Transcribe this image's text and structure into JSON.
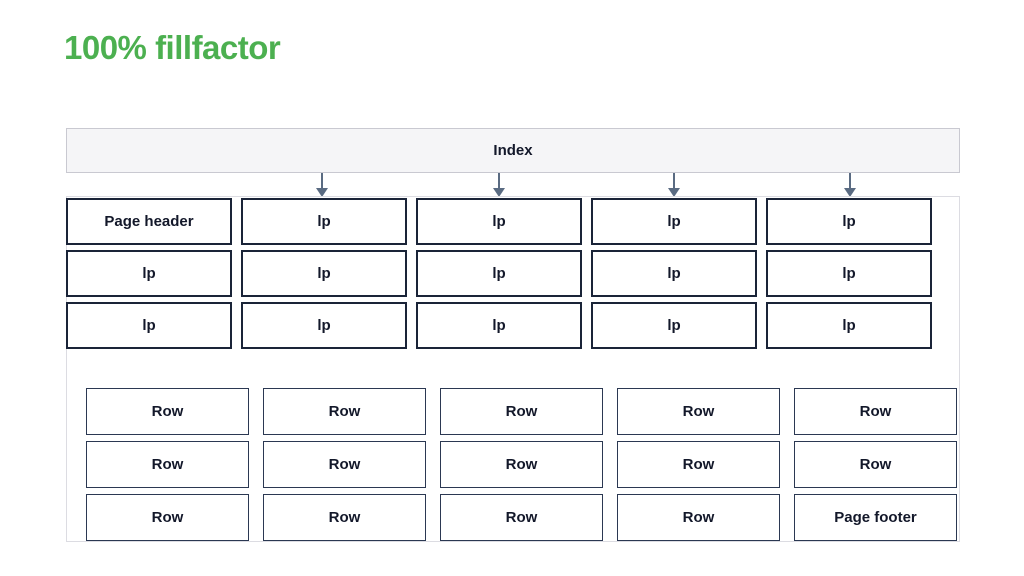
{
  "slide": {
    "title": "100% fillfactor",
    "title_color": "#4cb050"
  },
  "index": {
    "label": "Index",
    "fill_color": "#f5f5f7",
    "border_color": "#c9c9d1"
  },
  "arrows": {
    "count": 4,
    "color": "#5a6b82",
    "targets": [
      "lp-column-2",
      "lp-column-3",
      "lp-column-4",
      "lp-column-5"
    ]
  },
  "page": {
    "border_color": "#dcdce2",
    "box_border_color": "#1a2438",
    "row_border_color": "#2b3852",
    "text_color": "#13182a"
  },
  "lp_grid": {
    "columns": 5,
    "rows": 3,
    "cells": [
      "Page header",
      "lp",
      "lp",
      "lp",
      "lp",
      "lp",
      "lp",
      "lp",
      "lp",
      "lp",
      "lp",
      "lp",
      "lp",
      "lp",
      "lp"
    ]
  },
  "row_grid": {
    "columns": 5,
    "rows": 3,
    "cells": [
      "Row",
      "Row",
      "Row",
      "Row",
      "Row",
      "Row",
      "Row",
      "Row",
      "Row",
      "Row",
      "Row",
      "Row",
      "Row",
      "Row",
      "Page footer"
    ]
  }
}
